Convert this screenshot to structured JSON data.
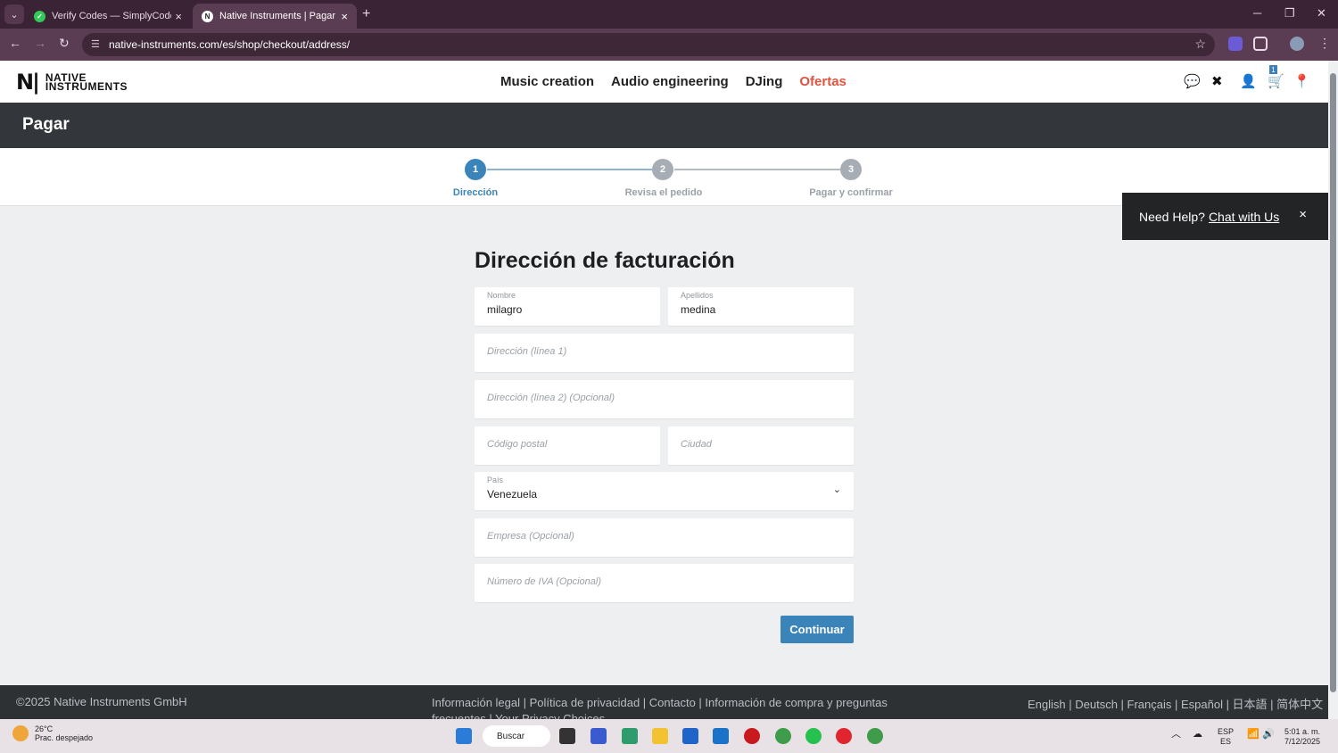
{
  "browser": {
    "tabs": [
      {
        "title": "Verify Codes — SimplyCodes",
        "favicon": "check-icon"
      },
      {
        "title": "Native Instruments | Pagar",
        "favicon": "ni-logo-icon",
        "active": true
      }
    ],
    "url": "native-instruments.com/es/shop/checkout/address/"
  },
  "site": {
    "logo_mark": "N|",
    "logo_line1": "NATIVE",
    "logo_line2": "INSTRUMENTS",
    "nav": [
      "Music creation",
      "Audio engineering",
      "DJing",
      "Ofertas"
    ],
    "cart_count": "1",
    "accent": "#3b84ba",
    "offer_color": "#e0533f"
  },
  "page": {
    "title": "Pagar"
  },
  "steps": [
    {
      "num": "1",
      "label": "Dirección",
      "active": true
    },
    {
      "num": "2",
      "label": "Revisa el pedido",
      "active": false
    },
    {
      "num": "3",
      "label": "Pagar y confirmar",
      "active": false
    }
  ],
  "help": {
    "text": "Need Help?",
    "link": "Chat with Us",
    "close": "×"
  },
  "form": {
    "title": "Dirección de facturación",
    "first_name": {
      "label": "Nombre",
      "value": "milagro"
    },
    "last_name": {
      "label": "Apellidos",
      "value": "medina"
    },
    "address1": {
      "placeholder": "Dirección (línea 1)"
    },
    "address2": {
      "placeholder": "Dirección (línea 2) (Opcional)"
    },
    "postal": {
      "placeholder": "Código postal"
    },
    "city": {
      "placeholder": "Ciudad"
    },
    "country": {
      "label": "País",
      "value": "Venezuela"
    },
    "company": {
      "placeholder": "Empresa (Opcional)"
    },
    "vat": {
      "placeholder": "Número de IVA (Opcional)"
    },
    "continue_label": "Continuar"
  },
  "footer": {
    "copyright": "©2025 Native Instruments GmbH",
    "links": "Información legal | Política de privacidad | Contacto | Información de compra y preguntas frecuentes | Your Privacy Choices",
    "languages": "English | Deutsch | Français | Español | 日本語 | 简体中文"
  },
  "taskbar": {
    "temp": "26°C",
    "weather": "Prac. despejado",
    "search": "Buscar",
    "lang1": "ESP",
    "lang2": "ES",
    "time": "5:01 a. m.",
    "date": "7/12/2025"
  }
}
